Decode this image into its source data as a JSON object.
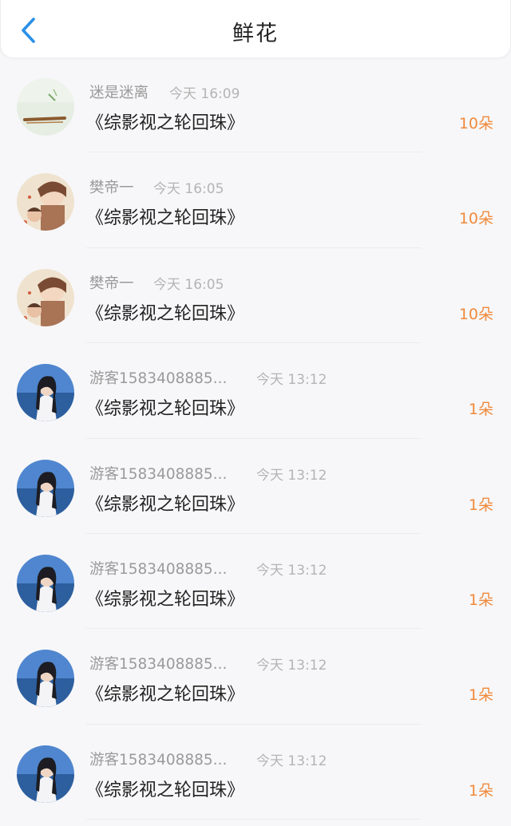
{
  "header": {
    "title": "鲜花",
    "back_icon": "chevron-left-icon",
    "accent_color": "#2a90e8"
  },
  "flower_color": "#f08a3c",
  "entries": [
    {
      "user": "迷是迷离",
      "time": "今天 16:09",
      "book": "《综影视之轮回珠》",
      "count": "10朵",
      "avatar": "guzheng-avatar"
    },
    {
      "user": "樊帝一",
      "time": "今天 16:05",
      "book": "《综影视之轮回珠》",
      "count": "10朵",
      "avatar": "anime-boy-avatar"
    },
    {
      "user": "樊帝一",
      "time": "今天 16:05",
      "book": "《综影视之轮回珠》",
      "count": "10朵",
      "avatar": "anime-boy-avatar"
    },
    {
      "user": "游客1583408885...",
      "time": "今天 13:12",
      "book": "《综影视之轮回珠》",
      "count": "1朵",
      "avatar": "sea-girl-avatar"
    },
    {
      "user": "游客1583408885...",
      "time": "今天 13:12",
      "book": "《综影视之轮回珠》",
      "count": "1朵",
      "avatar": "sea-girl-avatar"
    },
    {
      "user": "游客1583408885...",
      "time": "今天 13:12",
      "book": "《综影视之轮回珠》",
      "count": "1朵",
      "avatar": "sea-girl-avatar"
    },
    {
      "user": "游客1583408885...",
      "time": "今天 13:12",
      "book": "《综影视之轮回珠》",
      "count": "1朵",
      "avatar": "sea-girl-avatar"
    },
    {
      "user": "游客1583408885...",
      "time": "今天 13:12",
      "book": "《综影视之轮回珠》",
      "count": "1朵",
      "avatar": "sea-girl-avatar"
    }
  ]
}
